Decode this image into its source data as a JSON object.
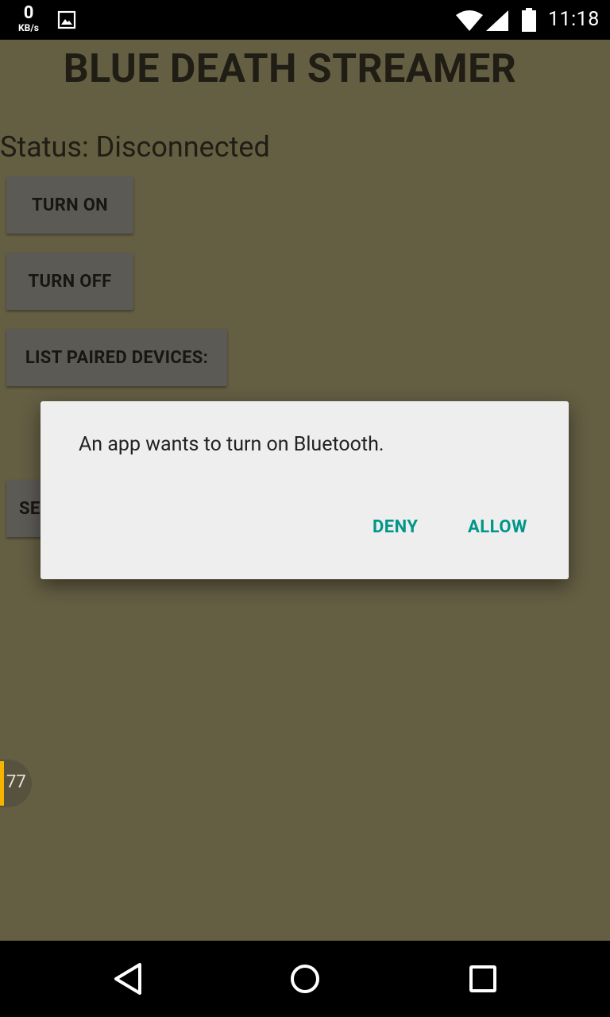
{
  "status_bar": {
    "speed_value": "0",
    "speed_unit": "KB/s",
    "time": "11:18",
    "icons": [
      "image-icon",
      "wifi-icon",
      "signal-icon",
      "battery-icon"
    ]
  },
  "app": {
    "title": "BLUE DEATH STREAMER",
    "status": "Status: Disconnected",
    "buttons": {
      "turn_on": "TURN ON",
      "turn_off": "TURN OFF",
      "list_paired": "LIST PAIRED DEVICES:",
      "partial": "SE"
    },
    "bubble_count": "77"
  },
  "dialog": {
    "message": "An app wants to turn on Bluetooth.",
    "deny": "DENY",
    "allow": "ALLOW"
  },
  "colors": {
    "app_background": "#645e43",
    "accent": "#009688",
    "bubble_bar": "#f4b400"
  },
  "nav_bar": {
    "icons": [
      "back-icon",
      "home-icon",
      "recents-icon"
    ]
  }
}
